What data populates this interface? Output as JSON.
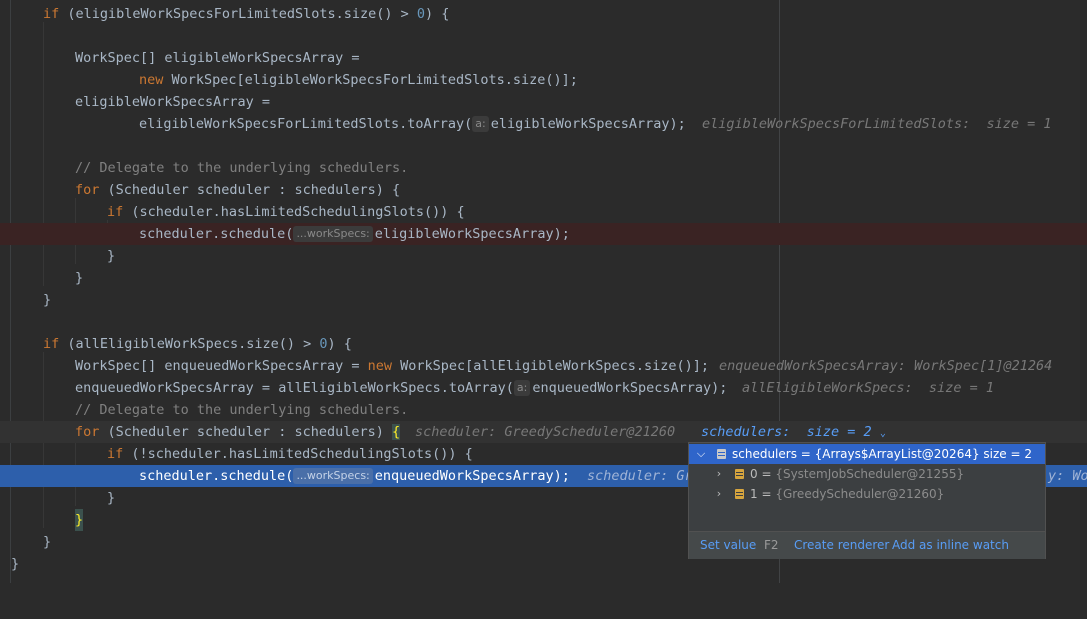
{
  "code": {
    "l1": {
      "kw": "if",
      "a": " (eligibleWorkSpecsForLimitedSlots.size() > ",
      "num": "0",
      "b": ") {"
    },
    "l3": {
      "a": "WorkSpec[] eligibleWorkSpecsArray ="
    },
    "l4": {
      "kw": "new",
      "a": " WorkSpec[eligibleWorkSpecsForLimitedSlots.size()];"
    },
    "l5": {
      "a": "eligibleWorkSpecsArray ="
    },
    "l6": {
      "a": "eligibleWorkSpecsForLimitedSlots.toArray(",
      "hint": "a:",
      "b": "eligibleWorkSpecsArray);",
      "inline": "eligibleWorkSpecsForLimitedSlots:  size = 1"
    },
    "l8": {
      "cmt": "// Delegate to the underlying schedulers."
    },
    "l9": {
      "kw": "for",
      "a": " (Scheduler scheduler : schedulers) {"
    },
    "l10": {
      "kw": "if",
      "a": " (scheduler.hasLimitedSchedulingSlots()) {"
    },
    "l11": {
      "a": "scheduler.schedule(",
      "hint": "...workSpecs:",
      "b": "eligibleWorkSpecsArray);"
    },
    "l12": {
      "a": "}"
    },
    "l13": {
      "a": "}"
    },
    "l14": {
      "a": "}"
    },
    "l16": {
      "kw": "if",
      "a": " (allEligibleWorkSpecs.size() > ",
      "num": "0",
      "b": ") {"
    },
    "l17": {
      "a": "WorkSpec[] enqueuedWorkSpecsArray = ",
      "kw": "new",
      "b": " WorkSpec[allEligibleWorkSpecs.size()];",
      "inline": "enqueuedWorkSpecsArray: WorkSpec[1]@21264"
    },
    "l18": {
      "a": "enqueuedWorkSpecsArray = allEligibleWorkSpecs.toArray(",
      "hint": "a:",
      "b": "enqueuedWorkSpecsArray);",
      "inline": "allEligibleWorkSpecs:  size = 1"
    },
    "l19": {
      "cmt": "// Delegate to the underlying schedulers."
    },
    "l20": {
      "kw": "for",
      "a": " (Scheduler scheduler : schedulers) ",
      "brace": "{",
      "inline": "scheduler: GreedyScheduler@21260",
      "inline_link": "schedulers:  size = 2"
    },
    "l21": {
      "kw": "if",
      "a": " (!scheduler.hasLimitedSchedulingSlots()) {"
    },
    "l22": {
      "a": "scheduler.schedule(",
      "hint": "...workSpecs:",
      "b": "enqueuedWorkSpecsArray);",
      "inline": "scheduler: Gr",
      "inline_tail": "y: Wor"
    },
    "l23": {
      "a": "}"
    },
    "l24": {
      "a": "}"
    },
    "l25": {
      "a": "}"
    },
    "l26": {
      "a": "}"
    }
  },
  "popup": {
    "root": {
      "name": "schedulers",
      "value": " = {Arrays$ArrayList@20264}  size = 2"
    },
    "children": [
      {
        "index": "0",
        "value": "{SystemJobScheduler@21255}"
      },
      {
        "index": "1",
        "value": "{GreedyScheduler@21260}"
      }
    ],
    "eq": " = ",
    "footer": {
      "set_value": "Set value",
      "set_value_shortcut": "F2",
      "create_renderer": "Create renderer",
      "add_inline_watch": "Add as inline watch"
    }
  },
  "icons": {
    "expanded": "chevron-down-icon",
    "collapsed": "chevron-right-icon",
    "field": "field-icon"
  }
}
